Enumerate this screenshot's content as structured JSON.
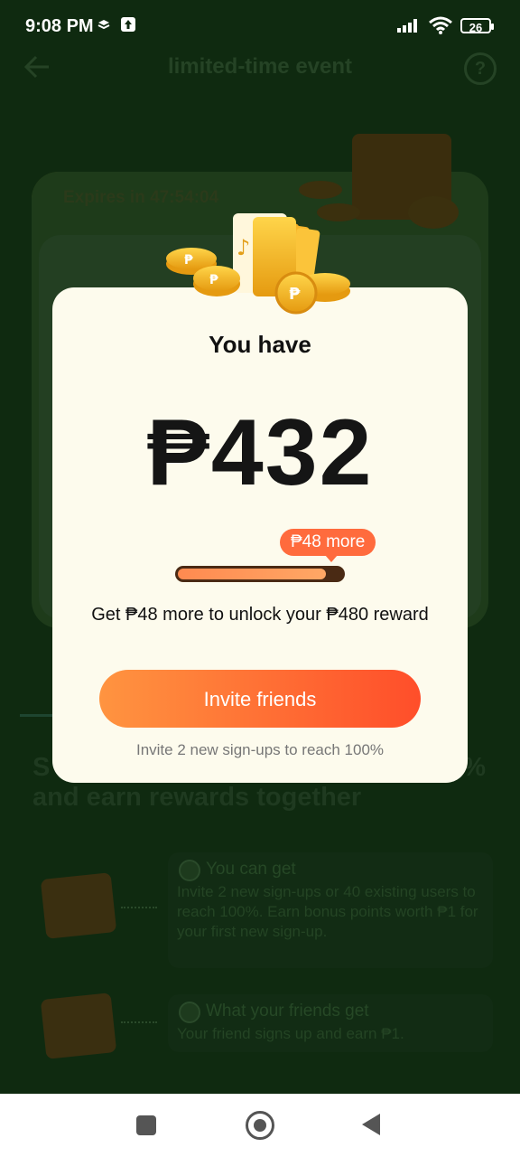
{
  "status_bar": {
    "time": "9:08 PM",
    "battery": "26"
  },
  "header": {
    "title": "limited-time event"
  },
  "event_card": {
    "expires": "Expires in 47:54:04"
  },
  "background_section": {
    "heading_line1_start": "S",
    "heading_line1_end": "%",
    "heading_line2": "and earn rewards together",
    "rows": [
      {
        "title": "You can get",
        "text": "Invite 2 new sign-ups or 40 existing users to reach 100%. Earn bonus points worth ₱1 for your first new sign-up."
      },
      {
        "title": "What your friends get",
        "text": "Your friend signs up and earn ₱1."
      }
    ]
  },
  "modal": {
    "heading": "You have",
    "amount": "₱432",
    "badge": "₱48 more",
    "progress_fraction": 0.9,
    "unlock_text": "Get ₱48 more to unlock your ₱480 reward",
    "button_label": "Invite friends",
    "note": "Invite 2 new sign-ups to reach 100%"
  },
  "colors": {
    "accent": "#ff6b3d",
    "button_start": "#ff9440",
    "button_end": "#ff4e2a",
    "overlay_bg": "#0f2a10",
    "modal_bg": "#fdfbed"
  }
}
